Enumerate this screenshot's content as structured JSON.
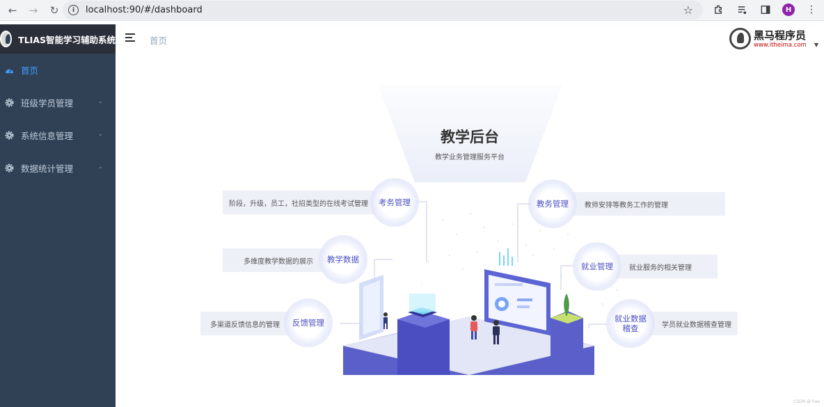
{
  "browser": {
    "url": "localhost:90/#/dashboard",
    "profile_initial": "H"
  },
  "sidebar": {
    "brand": "TLIAS智能学习辅助系统",
    "items": [
      {
        "label": "首页",
        "icon": "dashboard-icon",
        "active": true
      },
      {
        "label": "班级学员管理",
        "icon": "gear-icon",
        "active": false
      },
      {
        "label": "系统信息管理",
        "icon": "gear-icon",
        "active": false
      },
      {
        "label": "数据统计管理",
        "icon": "gear-icon",
        "active": false
      }
    ]
  },
  "header": {
    "breadcrumb": "首页",
    "logo_name": "黑马程序员",
    "logo_url": "www.itheima.com"
  },
  "dashboard": {
    "title": "教学后台",
    "subtitle": "教学业务管理服务平台",
    "modules": [
      {
        "label": "考务管理",
        "desc": "阶段，升级，员工，社招类型的在线考试管理"
      },
      {
        "label": "教学数据",
        "desc": "多维度教学数据的展示"
      },
      {
        "label": "反馈管理",
        "desc": "多渠道反馈信息的管理"
      },
      {
        "label": "教务管理",
        "desc": "教师安排等教务工作的管理"
      },
      {
        "label": "就业管理",
        "desc": "就业服务的相关管理"
      },
      {
        "label": "就业数据\n稽查",
        "desc": "学员就业数据稽查管理"
      }
    ],
    "watermark": "CSDN @ hao"
  },
  "colors": {
    "sidebar_bg": "#304156",
    "brand_bg": "#2b2f3a",
    "active": "#409eff",
    "menu_text": "#bfcbd9",
    "bubble_text": "#4b4fc2"
  }
}
